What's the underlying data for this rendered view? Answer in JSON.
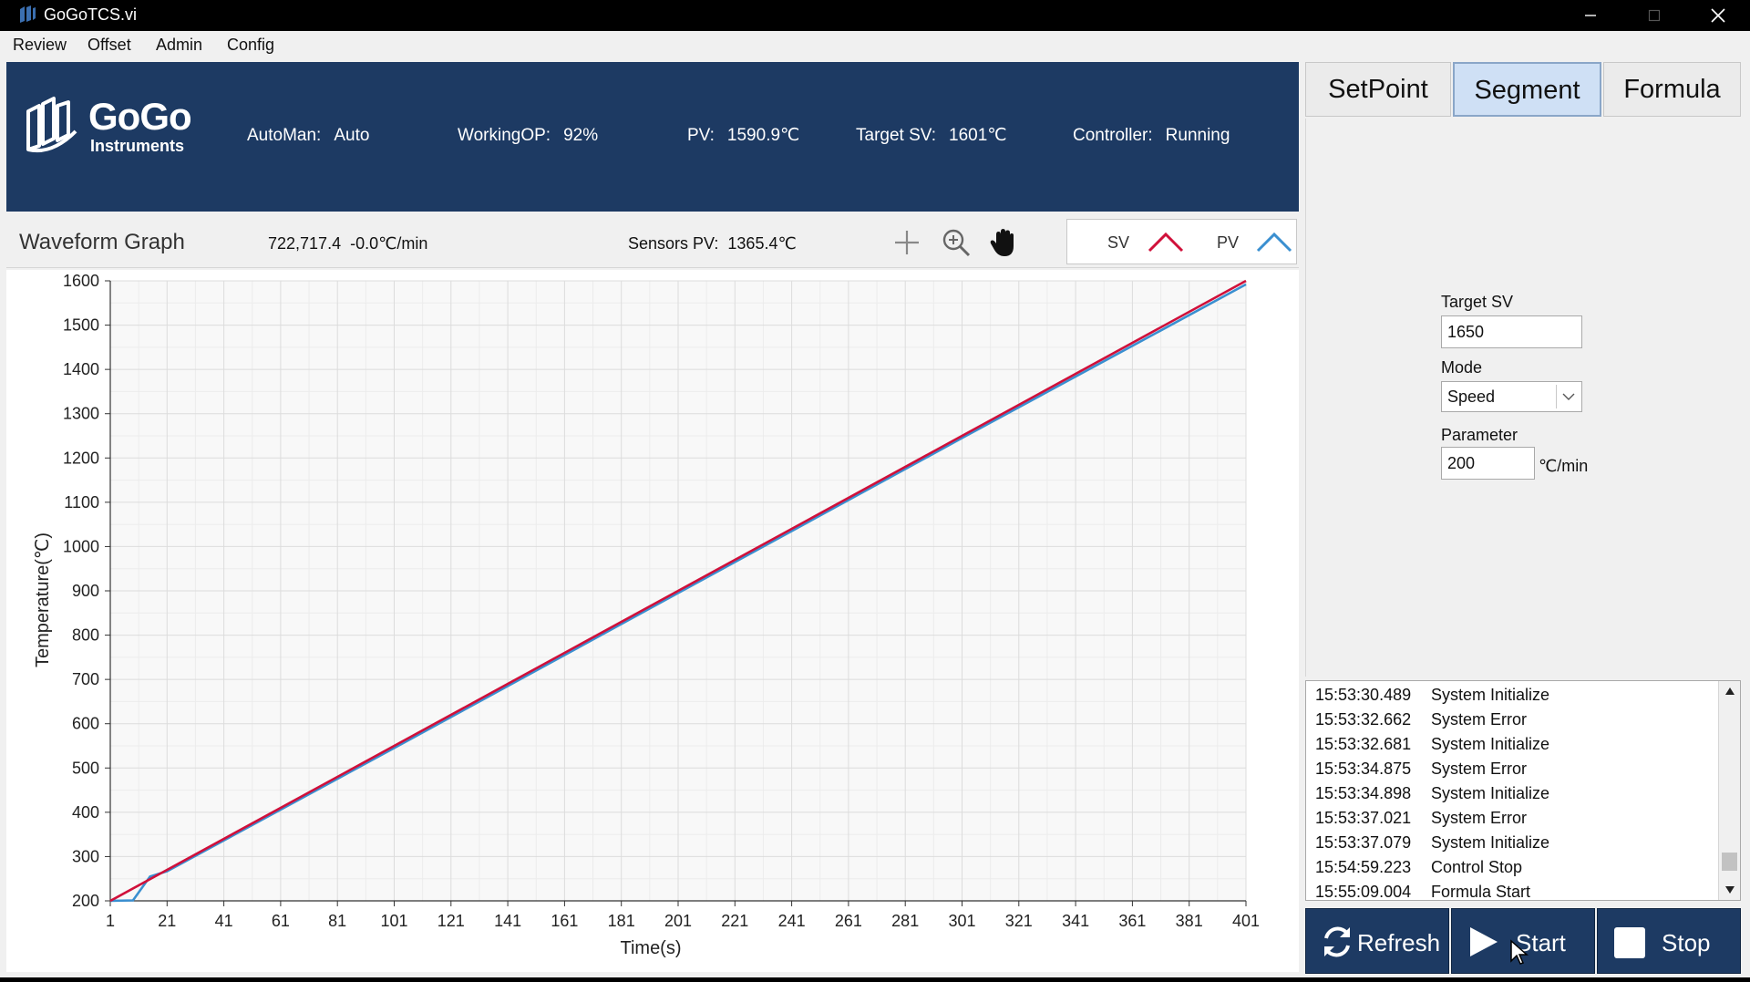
{
  "window": {
    "title": "GoGoTCS.vi"
  },
  "menu": [
    "Review",
    "Offset",
    "Admin",
    "Config"
  ],
  "header": {
    "logo_word": "GoGo",
    "logo_sub": "Instruments",
    "stats": [
      {
        "label": "AutoMan:",
        "value": "Auto"
      },
      {
        "label": "WorkingOP:",
        "value": "92%"
      },
      {
        "label": "PV:",
        "value": "1590.9℃"
      },
      {
        "label": "Target SV:",
        "value": "1601℃"
      },
      {
        "label": "Controller:",
        "value": "Running"
      }
    ]
  },
  "tabs": [
    {
      "label": "SetPoint",
      "active": false
    },
    {
      "label": "Segment",
      "active": true
    },
    {
      "label": "Formula",
      "active": false
    }
  ],
  "form": {
    "target_sv_label": "Target SV",
    "target_sv_value": "1650",
    "mode_label": "Mode",
    "mode_value": "Speed",
    "parameter_label": "Parameter",
    "parameter_value": "200",
    "parameter_unit": "℃/min"
  },
  "log": [
    {
      "time": "15:53:30.489",
      "msg": "System Initialize"
    },
    {
      "time": "15:53:32.662",
      "msg": "System Error"
    },
    {
      "time": "15:53:32.681",
      "msg": "System Initialize"
    },
    {
      "time": "15:53:34.875",
      "msg": "System Error"
    },
    {
      "time": "15:53:34.898",
      "msg": "System Initialize"
    },
    {
      "time": "15:53:37.021",
      "msg": "System Error"
    },
    {
      "time": "15:53:37.079",
      "msg": "System Initialize"
    },
    {
      "time": "15:54:59.223",
      "msg": "Control Stop"
    },
    {
      "time": "15:55:09.004",
      "msg": "Formula Start"
    }
  ],
  "buttons": {
    "refresh": "Refresh",
    "start": "Start",
    "stop": "Stop"
  },
  "graph": {
    "title": "Waveform Graph",
    "cursor": "722,717.4",
    "rate": "-0.0℃/min",
    "sensors_label": "Sensors PV:",
    "sensors_value": "1365.4℃",
    "tools": [
      "crosshair-icon",
      "zoom-icon",
      "pan-hand-icon"
    ],
    "legend_sv": "SV",
    "legend_pv": "PV"
  },
  "colors": {
    "header_bg": "#1d3a63",
    "sv": "#d0103a",
    "pv": "#3a8fd0",
    "tab_active": "#cfe0f5"
  },
  "chart_data": {
    "type": "line",
    "xlabel": "Time(s)",
    "ylabel": "Temperature(℃)",
    "xlim": [
      1,
      401
    ],
    "ylim": [
      200,
      1600
    ],
    "xticks": [
      1,
      21,
      41,
      61,
      81,
      101,
      121,
      141,
      161,
      181,
      201,
      221,
      241,
      261,
      281,
      301,
      321,
      341,
      361,
      381,
      401
    ],
    "yticks": [
      200,
      300,
      400,
      500,
      600,
      700,
      800,
      900,
      1000,
      1100,
      1200,
      1300,
      1400,
      1500,
      1600
    ],
    "grid": true,
    "series": [
      {
        "name": "SV",
        "color": "#d0103a",
        "x": [
          1,
          21,
          101,
          201,
          301,
          401
        ],
        "y": [
          200,
          270,
          550,
          900,
          1250,
          1600
        ]
      },
      {
        "name": "PV",
        "color": "#3a8fd0",
        "x": [
          1,
          9,
          15,
          21,
          101,
          201,
          301,
          401
        ],
        "y": [
          200,
          201,
          255,
          267,
          545,
          895,
          1245,
          1592
        ]
      }
    ]
  }
}
